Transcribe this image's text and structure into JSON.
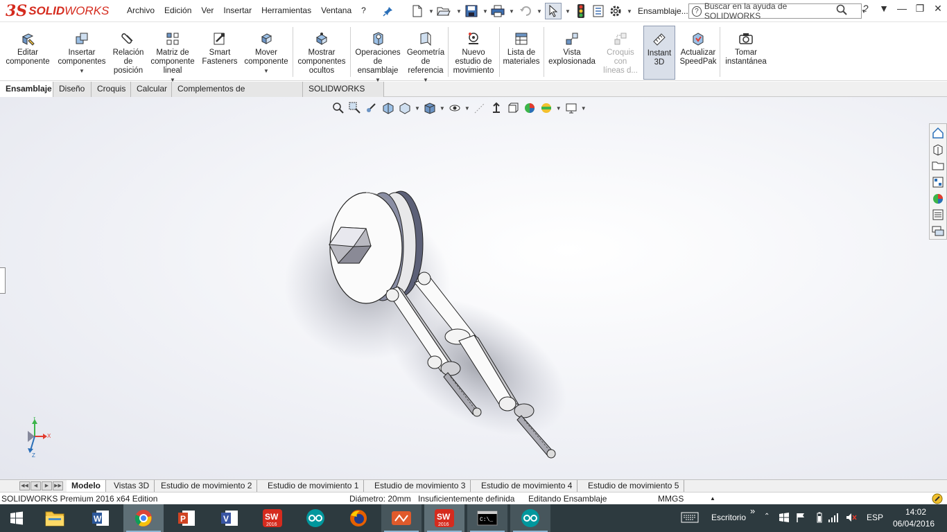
{
  "app": {
    "logo_ds": "3S",
    "logo_name_bold": "SOLID",
    "logo_name_rest": "WORKS",
    "brand_color": "#d52b1e"
  },
  "menu": [
    "Archivo",
    "Edición",
    "Ver",
    "Insertar",
    "Herramientas",
    "Ventana",
    "?"
  ],
  "toolbar_icons": [
    "pin-icon",
    "new-icon",
    "open-icon",
    "save-icon",
    "print-icon",
    "undo-icon",
    "select-icon",
    "rebuild-icon",
    "file-properties-icon",
    "options-icon"
  ],
  "document_label": "Ensamblaje...",
  "help_search": {
    "placeholder": "Buscar en la ayuda de SOLIDWORKS",
    "help_glyph": "?"
  },
  "commands": [
    {
      "label": "Editar\ncomponente",
      "icon": "edit-component-icon"
    },
    {
      "label": "Insertar\ncomponentes",
      "icon": "insert-components-icon"
    },
    {
      "label": "Relación\nde\nposición",
      "icon": "mate-icon"
    },
    {
      "label": "Matriz de\ncomponente\nlineal",
      "icon": "linear-pattern-icon"
    },
    {
      "label": "Smart\nFasteners",
      "icon": "smart-fasteners-icon"
    },
    {
      "label": "Mover\ncomponente",
      "icon": "move-component-icon"
    },
    {
      "label": "Mostrar\ncomponentes\nocultos",
      "icon": "show-hidden-icon"
    },
    {
      "label": "Operaciones\nde\nensamblaje",
      "icon": "assembly-features-icon"
    },
    {
      "label": "Geometría\nde\nreferencia",
      "icon": "reference-geometry-icon"
    },
    {
      "label": "Nuevo\nestudio de\nmovimiento",
      "icon": "motion-study-icon"
    },
    {
      "label": "Lista de\nmateriales",
      "icon": "bom-icon"
    },
    {
      "label": "Vista\nexplosionada",
      "icon": "exploded-view-icon"
    },
    {
      "label": "Croquis\ncon\nlíneas d...",
      "icon": "explode-line-sketch-icon"
    },
    {
      "label": "Instant\n3D",
      "icon": "instant3d-icon"
    },
    {
      "label": "Actualizar\nSpeedPak",
      "icon": "speedpak-icon"
    },
    {
      "label": "Tomar\ninstantánea",
      "icon": "snapshot-icon"
    }
  ],
  "cm_tabs": [
    "Ensamblaje",
    "Diseño",
    "Croquis",
    "Calcular",
    "Complementos de SOLIDWORKS",
    "SOLIDWORKS MBD"
  ],
  "triad": {
    "y": "Y",
    "x": "X",
    "z": "Z"
  },
  "bottom_tabs": [
    "Modelo",
    "Vistas 3D",
    "Estudio de movimiento 2",
    "Estudio de movimiento 1",
    "Estudio de movimiento 3",
    "Estudio de movimiento 4",
    "Estudio de movimiento 5"
  ],
  "status": {
    "edition": "SOLIDWORKS Premium 2016 x64 Edition",
    "dimension": "Diámetro: 20mm",
    "definition": "Insuficientemente definida",
    "mode": "Editando Ensamblaje",
    "units": "MMGS",
    "units_caret": "▲"
  },
  "taskbar": {
    "desktop_label": "Escritorio",
    "desktop_chevron": "»",
    "language": "ESP",
    "time": "14:02",
    "date": "06/04/2016",
    "sw_badge": "2016",
    "cmd_prompt": "C:\\_"
  }
}
